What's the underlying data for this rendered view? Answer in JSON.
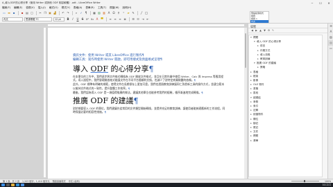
{
  "window": {
    "title": "A_導入ODF的心得分享（使用 Writer 或其他 ODF 相容軟體）.odt - LibreOffice Writer",
    "min": "─",
    "max": "☐",
    "close": "✕"
  },
  "menu": [
    "檔案(F)",
    "編輯(E)",
    "檢視(V)",
    "插入(I)",
    "格式(O)",
    "樣式(Y)",
    "表格(A)",
    "表單(R)",
    "工具(T)",
    "視窗(W)",
    "說明(H)"
  ],
  "toolbar": {
    "style_combo": "內文",
    "font_combo": "思源黑體 TC",
    "size_combo": "12 pt",
    "styles_list": [
      "預設段落樣式",
      "標題",
      "標題 1",
      "內文"
    ]
  },
  "document": {
    "link_lines": [
      "資訊文件：使用 Writer 或其 LibreOffice 進行製作¶",
      "編輯工具：寫作時使用 Writer 開啟，即可用樣式及頁面格式呈現¶"
    ],
    "heading1_prefix": "導入 ",
    "heading1_odf": "ODF",
    "heading1_suffix": " 的心得分享",
    "para1": "在本單位的工作中，我們逐步將文件格式轉換為 ODF 開放文件格式，並且在日常作業中使用 Writer、Calc 與 Impress 等應用程式。導入過程中，我們發現開放格式能讓文件在不同平台間順利交換，也減少了對特定商業軟體的依賴。",
    "para2": "此外，ODF 標準有明確的規範，使得文件在長期保存上更加可靠。我們也透過教育訓練讓同仁熟悉新工具的操作方式，並建立範本以維持文件格式的一致性，提升整體工作效率。",
    "para3": "最後，我們認為導入 ODF 是一項值得推廣的做法，建議其他單位也能參考我們的經驗，循序漸進地完成轉換。",
    "heading2": "推廣 ODF 的建議",
    "para4": "對於想要導入 ODF 的單位，我們建議先從常用的文件類型開始轉換，並提供充足的教育訓練，讓使用者能夠適應新的工作流程，同時保留必要的相容性措施。",
    "pilcrow": "¶"
  },
  "navigator": {
    "title": "導覽",
    "tools": [
      "◀",
      "▶",
      "▲",
      "▼",
      "⚙",
      "✎"
    ],
    "items": [
      {
        "label": "標題",
        "level": 0,
        "expanded": true
      },
      {
        "label": "導入 ODF 的心得分享",
        "level": 1,
        "expanded": true
      },
      {
        "label": "前言",
        "level": 2,
        "expanded": false
      },
      {
        "label": "作業方式",
        "level": 2,
        "expanded": false
      },
      {
        "label": "導入流程",
        "level": 2,
        "expanded": false
      },
      {
        "label": "教育訓練",
        "level": 2,
        "expanded": false
      },
      {
        "label": "推廣 ODF 的建議",
        "level": 1,
        "expanded": true
      },
      {
        "label": "策略",
        "level": 2,
        "expanded": false
      },
      {
        "label": "表格",
        "level": 0,
        "expanded": false
      },
      {
        "label": "框架",
        "level": 0,
        "expanded": false
      },
      {
        "label": "影像",
        "level": 0,
        "expanded": false
      },
      {
        "label": "OLE 物件",
        "level": 0,
        "expanded": false
      },
      {
        "label": "書籤",
        "level": 0,
        "expanded": false
      },
      {
        "label": "區段",
        "level": 0,
        "expanded": false
      },
      {
        "label": "超連結",
        "level": 0,
        "expanded": true
      },
      {
        "label": "參照",
        "level": 0,
        "expanded": false
      },
      {
        "label": "索引",
        "level": 0,
        "expanded": false
      },
      {
        "label": "註解",
        "level": 0,
        "expanded": false
      },
      {
        "label": "繪圖物件",
        "level": 0,
        "expanded": false
      },
      {
        "label": "欄位",
        "level": 0,
        "expanded": false
      },
      {
        "label": "腳註",
        "level": 0,
        "expanded": false
      },
      {
        "label": "尾註",
        "level": 0,
        "expanded": false
      },
      {
        "label": "文件",
        "level": 0,
        "expanded": false
      },
      {
        "label": "標題",
        "level": 0,
        "expanded": false
      },
      {
        "label": "清單",
        "level": 0,
        "expanded": false
      }
    ]
  },
  "status": {
    "page": "第 1 頁，共 2 頁",
    "words": "1,203 個字，1,410 個字元",
    "style": "預設頁面樣式",
    "lang": "中文 (台灣)",
    "zoom": "100%"
  },
  "taskbar": {
    "time": "上午 10:24",
    "date": "2021/4/12"
  },
  "colors": {
    "link": "#2a5db0",
    "selection": "#2f7ad1",
    "taskbar": "#1b1e24"
  }
}
